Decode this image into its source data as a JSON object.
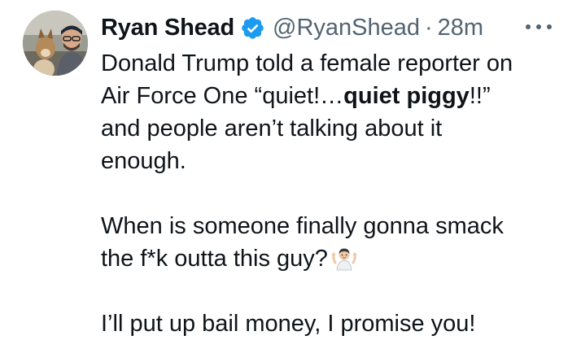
{
  "author": {
    "display_name": "Ryan Shead",
    "handle": "@RyanShead",
    "separator": "·",
    "time": "28m",
    "verified_icon": "verified-badge-icon",
    "avatar": "profile-photo"
  },
  "menu": {
    "icon": "more-options-icon"
  },
  "tweet": {
    "line1": "Donald Trump told a female reporter on",
    "line2_pre": "Air Force One “quiet!…",
    "line2_bold": "quiet piggy",
    "line2_post": "!!”",
    "line3": "and people aren’t talking about it",
    "line4": "enough.",
    "line5": "When is someone finally gonna smack",
    "line6": "the f*k outta this guy?",
    "line6_emoji": "person-shrugging-emoji",
    "line7": "I’ll put up bail money, I promise you!"
  },
  "colors": {
    "text": "#0f1419",
    "secondary": "#536471",
    "verified": "#1d9bf0"
  }
}
